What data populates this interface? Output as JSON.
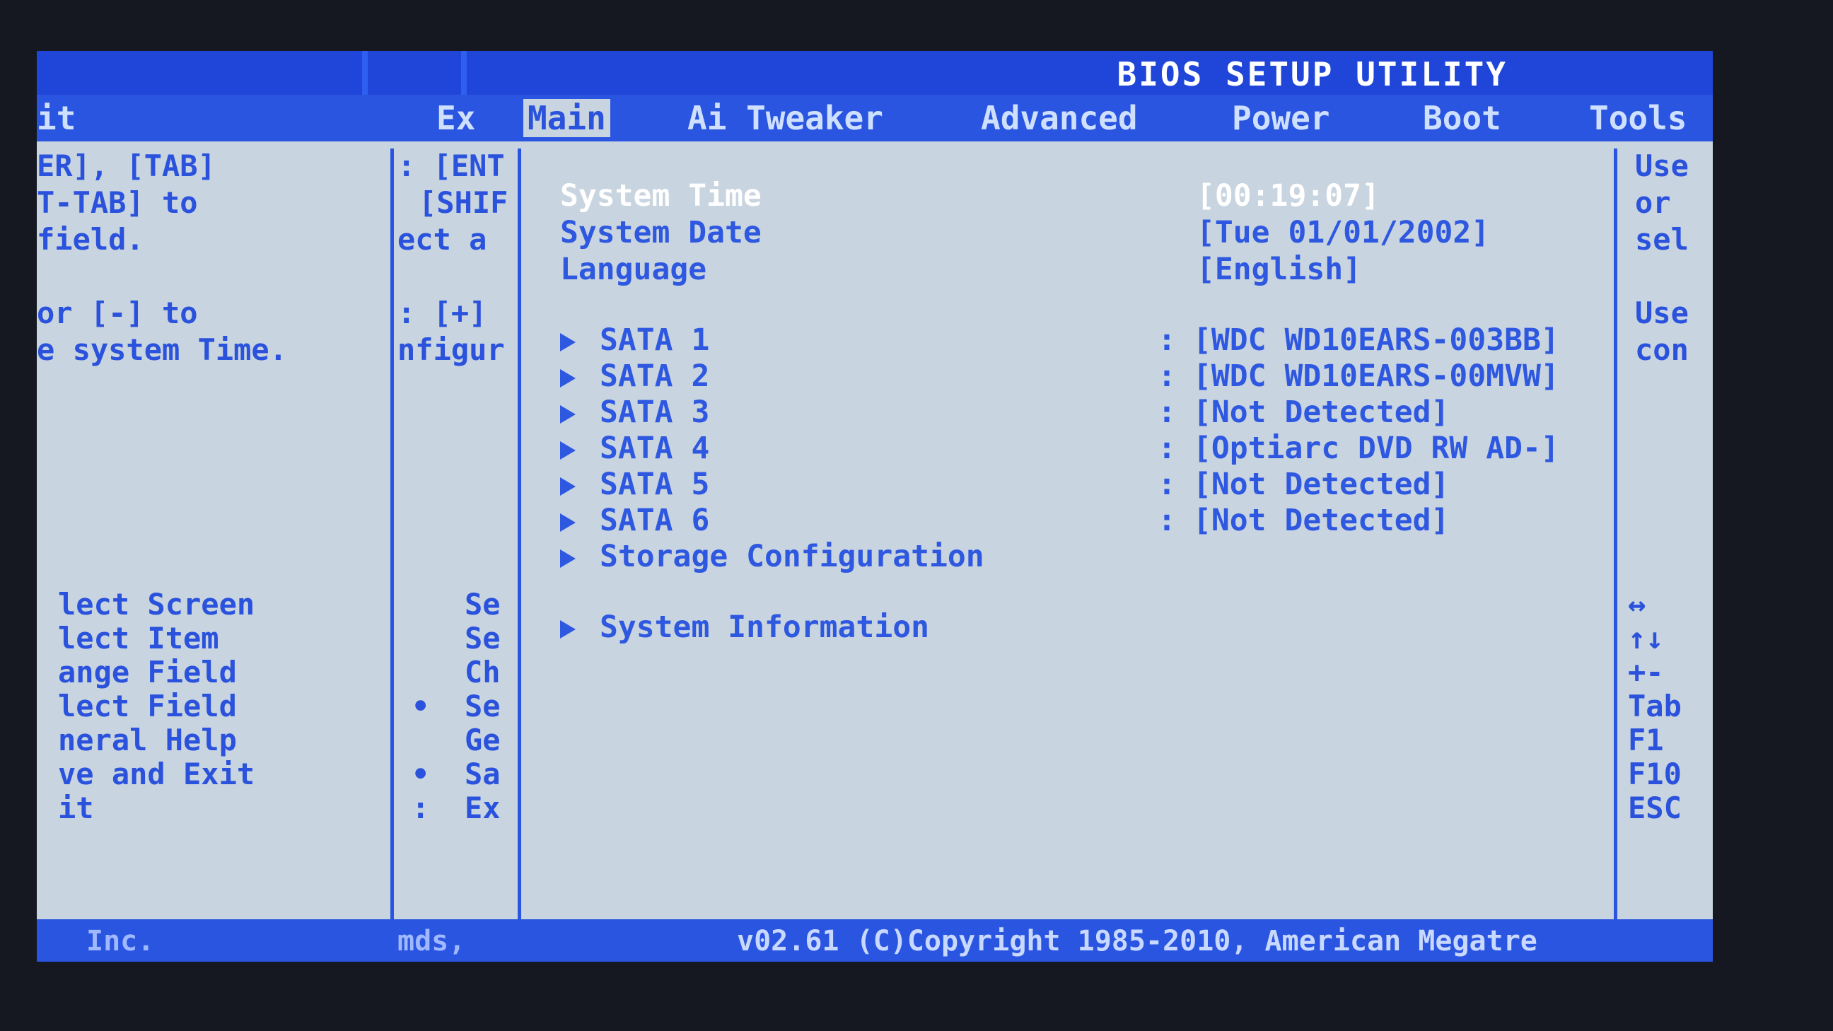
{
  "title": "BIOS SETUP UTILITY",
  "tabs": [
    {
      "label": "it"
    },
    {
      "label": "Ex"
    },
    {
      "label": "Main"
    },
    {
      "label": "Ai Tweaker"
    },
    {
      "label": "Advanced"
    },
    {
      "label": "Power"
    },
    {
      "label": "Boot"
    },
    {
      "label": "Tools"
    }
  ],
  "left_panel": {
    "help_lines": [
      "ER], [TAB]",
      "T-TAB] to",
      " field.",
      "or [-] to",
      "e system Time."
    ],
    "keys": [
      "lect Screen",
      "lect Item",
      "ange Field",
      "lect Field",
      "neral Help",
      "ve and Exit",
      "it"
    ]
  },
  "mid_panel": {
    "help_lines": [
      ": [ENT",
      "[SHIF",
      "ect a",
      ": [+]",
      "nfigur"
    ],
    "keys": [
      "Se",
      "Se",
      "Ch",
      "Se",
      "Ge",
      "Sa",
      "Ex"
    ],
    "marks": [
      "",
      "",
      "",
      "•",
      "",
      "•",
      ":"
    ]
  },
  "main": {
    "system_time_label": "System Time",
    "system_time_value": "[00:19:07]",
    "system_date_label": "System Date",
    "system_date_value": "[Tue 01/01/2002]",
    "language_label": "Language",
    "language_value": "[English]",
    "sata": [
      {
        "label": "SATA 1",
        "value": "[WDC WD10EARS-003BB]"
      },
      {
        "label": "SATA 2",
        "value": "[WDC WD10EARS-00MVW]"
      },
      {
        "label": "SATA 3",
        "value": "[Not Detected]"
      },
      {
        "label": "SATA 4",
        "value": "[Optiarc DVD RW AD-]"
      },
      {
        "label": "SATA 5",
        "value": "[Not Detected]"
      },
      {
        "label": "SATA 6",
        "value": "[Not Detected]"
      }
    ],
    "storage_config": "Storage Configuration",
    "system_info": "System Information"
  },
  "right_panel": {
    "help_lines": [
      "Use",
      "or",
      "sel",
      "Use",
      "con"
    ],
    "keys": [
      "↔",
      "↑↓",
      "+-",
      "Tab",
      "F1",
      "F10",
      "ESC"
    ]
  },
  "footer": {
    "left": "Inc.",
    "mid": "mds,",
    "copyright": "v02.61 (C)Copyright 1985-2010, American Megatre"
  },
  "colors": {
    "blue": "#2a55e0",
    "panel": "#c8d4df",
    "text_blue": "#2f58e0",
    "highlight": "#ffffff"
  }
}
